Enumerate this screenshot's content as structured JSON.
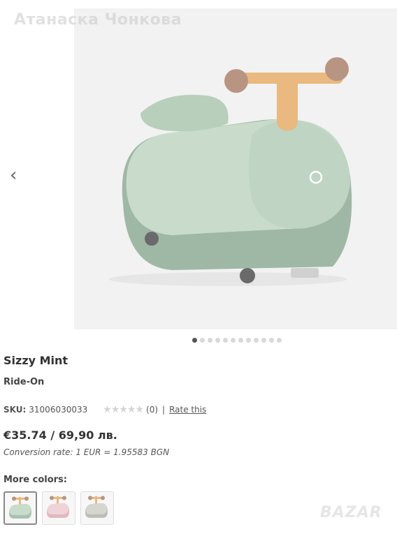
{
  "gallery": {
    "watermark": "Атанаска Чонкова",
    "prev_icon": "‹",
    "dots_total": 12,
    "active_dot": 0
  },
  "product": {
    "name": "Sizzy Mint",
    "category": "Ride-On",
    "sku_label": "SKU:",
    "sku": "31006030033",
    "rating_count": "(0)",
    "separator": "|",
    "rate_link": "Rate this",
    "price": "€35.74 / 69,90 лв.",
    "conversion": "Conversion rate: 1 EUR = 1.95583 BGN",
    "more_colors_label": "More colors:",
    "colors": [
      {
        "name": "mint",
        "body": "#c9dccb",
        "base": "#a9c2b0"
      },
      {
        "name": "pink",
        "body": "#f0d3d8",
        "base": "#e2b7bf"
      },
      {
        "name": "grey",
        "body": "#d6d6d0",
        "base": "#bdbdb5"
      }
    ]
  },
  "brand_mark": "BAZAR",
  "colors": {
    "toy_body": "#c9dccb",
    "toy_base": "#9fb8a6",
    "wood": "#e9b97f",
    "knob": "#b89582"
  }
}
